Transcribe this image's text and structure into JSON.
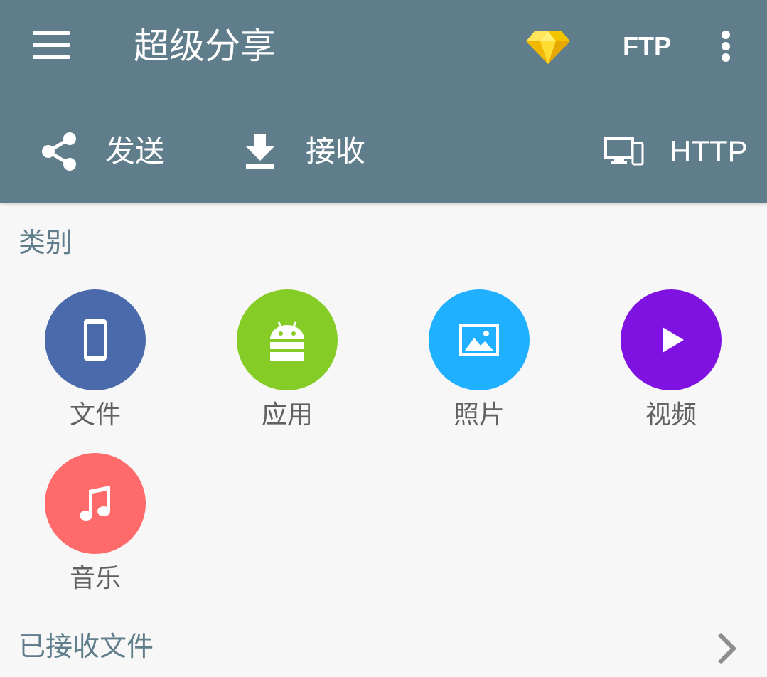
{
  "app": {
    "title": "超级分享",
    "ftp_label": "FTP",
    "accent_color": "#607d8b"
  },
  "actions": {
    "send_label": "发送",
    "receive_label": "接收",
    "http_label": "HTTP"
  },
  "categories": {
    "title": "类别",
    "items": [
      {
        "label": "文件",
        "color": "#4a6aab",
        "icon": "smartphone-icon"
      },
      {
        "label": "应用",
        "color": "#86cc26",
        "icon": "android-icon"
      },
      {
        "label": "照片",
        "color": "#1fb0ff",
        "icon": "image-icon"
      },
      {
        "label": "视频",
        "color": "#7f12e0",
        "icon": "play-icon"
      },
      {
        "label": "音乐",
        "color": "#ff6b6b",
        "icon": "music-note-icon"
      }
    ]
  },
  "received": {
    "title": "已接收文件"
  }
}
